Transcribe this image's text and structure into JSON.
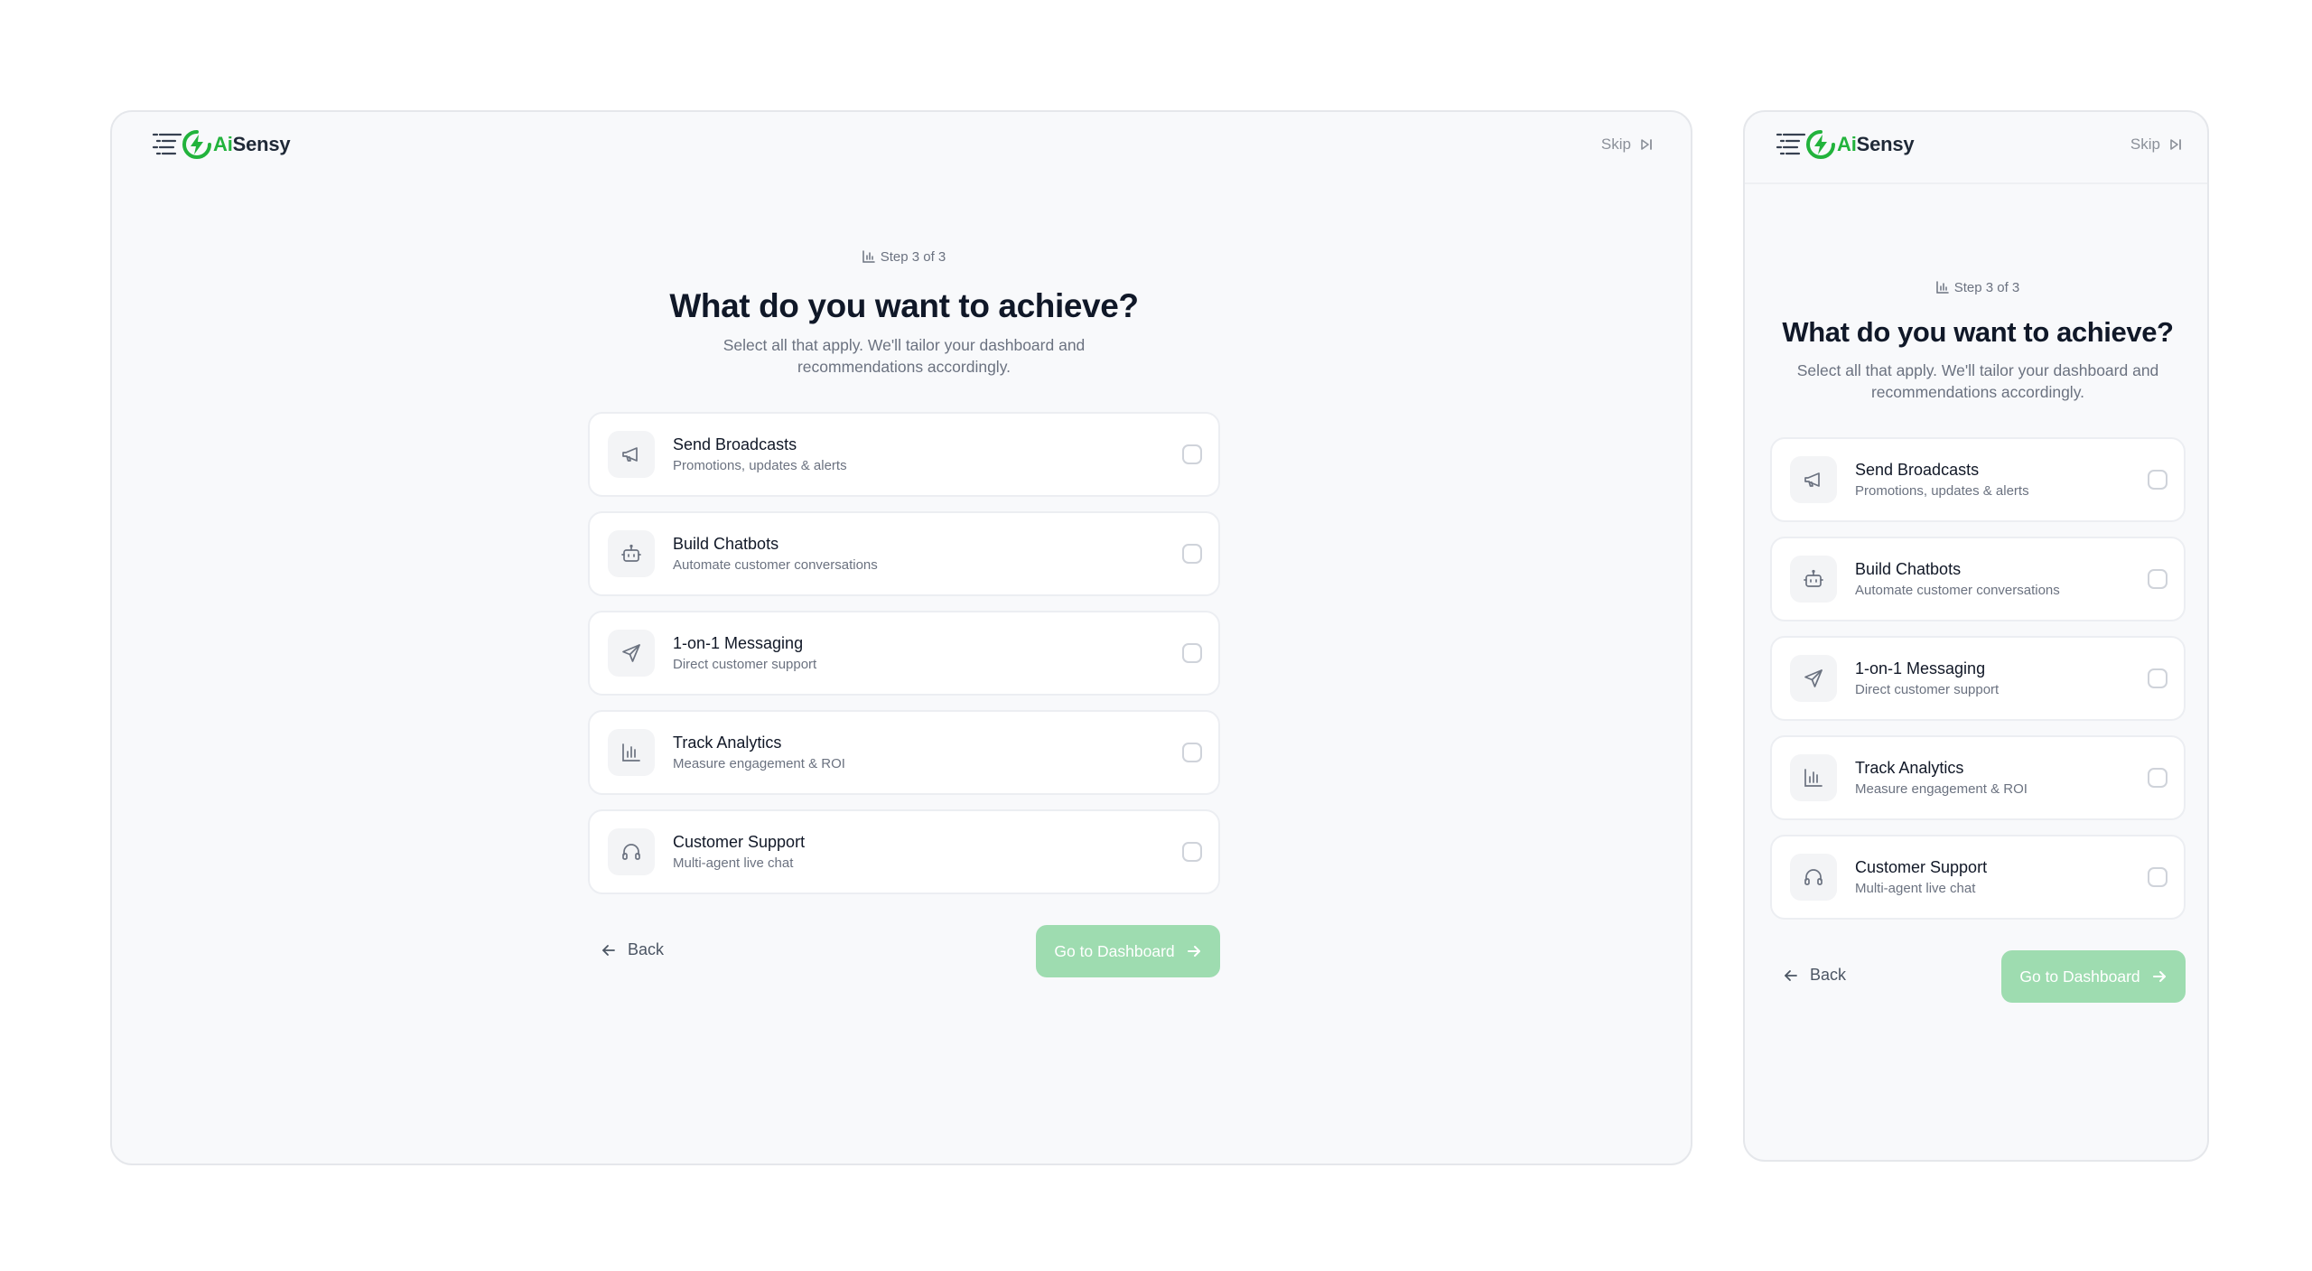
{
  "brand": {
    "ai": "Ai",
    "sensy": "Sensy",
    "accent": "#22b33c"
  },
  "header": {
    "skip_label": "Skip"
  },
  "step": "Step 3 of 3",
  "title": "What do you want to achieve?",
  "subtitle": "Select all that apply. We'll tailor your dashboard and recommendations accordingly.",
  "options": [
    {
      "title": "Send Broadcasts",
      "desc": "Promotions, updates & alerts",
      "icon": "megaphone-icon",
      "checked": false
    },
    {
      "title": "Build Chatbots",
      "desc": "Automate customer conversations",
      "icon": "bot-icon",
      "checked": false
    },
    {
      "title": "1-on-1 Messaging",
      "desc": "Direct customer support",
      "icon": "send-icon",
      "checked": false
    },
    {
      "title": "Track Analytics",
      "desc": "Measure engagement & ROI",
      "icon": "bar-chart-icon",
      "checked": false
    },
    {
      "title": "Customer Support",
      "desc": "Multi-agent live chat",
      "icon": "headphones-icon",
      "checked": false
    }
  ],
  "actions": {
    "back_label": "Back",
    "primary_label": "Go to Dashboard",
    "primary_color": "#9edcb0"
  }
}
